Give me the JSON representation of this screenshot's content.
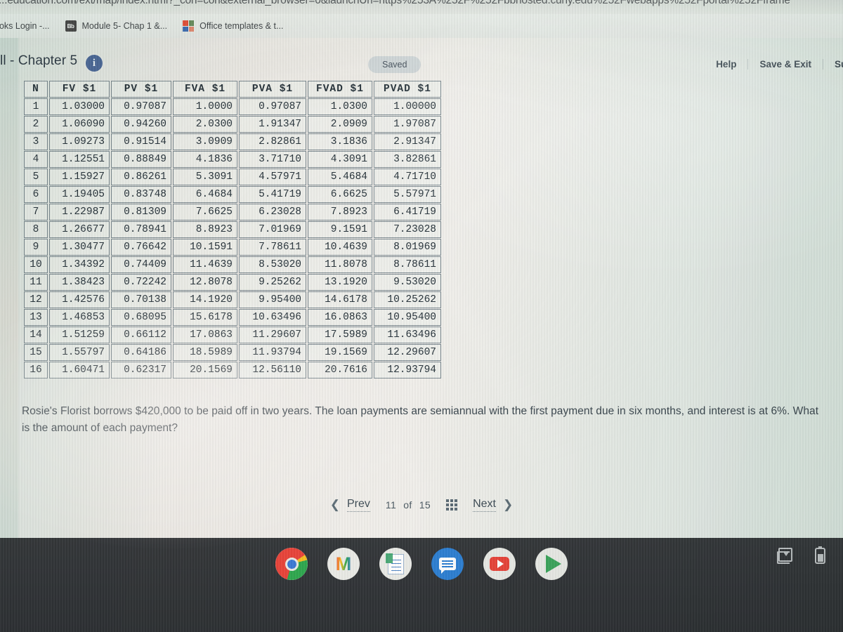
{
  "browser": {
    "url_text": "...education.com/ext/map/index.html?_con=con&external_browser=0&launchUrl=https%253A%252F%252Fbbhosted.cuny.edu%252Fwebapps%252Fportal%252Fframe",
    "bookmarks": [
      {
        "label": "ooks Login -...",
        "icon": "none"
      },
      {
        "label": "Module 5- Chap 1 &...",
        "icon": "blackboard-icon"
      },
      {
        "label": "Office templates & t...",
        "icon": "microsoft-icon"
      }
    ]
  },
  "app": {
    "title": "ll - Chapter 5",
    "info_icon": "info-icon",
    "status_badge": "Saved",
    "actions": [
      {
        "label": "Help"
      },
      {
        "label": "Save & Exit"
      },
      {
        "label": "Su"
      }
    ]
  },
  "table": {
    "headers": [
      "N",
      "FV $1",
      "PV $1",
      "FVA $1",
      "PVA $1",
      "FVAD $1",
      "PVAD $1"
    ],
    "rows": [
      [
        "1",
        "1.03000",
        "0.97087",
        "1.0000",
        "0.97087",
        "1.0300",
        "1.00000"
      ],
      [
        "2",
        "1.06090",
        "0.94260",
        "2.0300",
        "1.91347",
        "2.0909",
        "1.97087"
      ],
      [
        "3",
        "1.09273",
        "0.91514",
        "3.0909",
        "2.82861",
        "3.1836",
        "2.91347"
      ],
      [
        "4",
        "1.12551",
        "0.88849",
        "4.1836",
        "3.71710",
        "4.3091",
        "3.82861"
      ],
      [
        "5",
        "1.15927",
        "0.86261",
        "5.3091",
        "4.57971",
        "5.4684",
        "4.71710"
      ],
      [
        "6",
        "1.19405",
        "0.83748",
        "6.4684",
        "5.41719",
        "6.6625",
        "5.57971"
      ],
      [
        "7",
        "1.22987",
        "0.81309",
        "7.6625",
        "6.23028",
        "7.8923",
        "6.41719"
      ],
      [
        "8",
        "1.26677",
        "0.78941",
        "8.8923",
        "7.01969",
        "9.1591",
        "7.23028"
      ],
      [
        "9",
        "1.30477",
        "0.76642",
        "10.1591",
        "7.78611",
        "10.4639",
        "8.01969"
      ],
      [
        "10",
        "1.34392",
        "0.74409",
        "11.4639",
        "8.53020",
        "11.8078",
        "8.78611"
      ],
      [
        "11",
        "1.38423",
        "0.72242",
        "12.8078",
        "9.25262",
        "13.1920",
        "9.53020"
      ],
      [
        "12",
        "1.42576",
        "0.70138",
        "14.1920",
        "9.95400",
        "14.6178",
        "10.25262"
      ],
      [
        "13",
        "1.46853",
        "0.68095",
        "15.6178",
        "10.63496",
        "16.0863",
        "10.95400"
      ],
      [
        "14",
        "1.51259",
        "0.66112",
        "17.0863",
        "11.29607",
        "17.5989",
        "11.63496"
      ],
      [
        "15",
        "1.55797",
        "0.64186",
        "18.5989",
        "11.93794",
        "19.1569",
        "12.29607"
      ],
      [
        "16",
        "1.60471",
        "0.62317",
        "20.1569",
        "12.56110",
        "20.7616",
        "12.93794"
      ]
    ]
  },
  "question": {
    "text": "Rosie's Florist borrows $420,000 to be paid off in two years. The loan payments are semiannual with the first payment due in six months, and interest is at 6%. What is the amount of each payment?"
  },
  "pager": {
    "prev_label": "Prev",
    "next_label": "Next",
    "current": "11",
    "of_label": "of",
    "total": "15",
    "grid_icon": "grid-icon"
  },
  "shelf": {
    "apps": [
      {
        "name": "chrome-icon",
        "active": true
      },
      {
        "name": "gmail-icon",
        "active": false
      },
      {
        "name": "google-docs-icon",
        "active": false
      },
      {
        "name": "messages-icon",
        "active": false
      },
      {
        "name": "youtube-icon",
        "active": false
      },
      {
        "name": "play-store-icon",
        "active": false
      }
    ],
    "tray": [
      {
        "name": "screen-capture-icon"
      },
      {
        "name": "battery-icon"
      }
    ]
  },
  "colors": {
    "accent_blue": "#4d6a9a",
    "page_bg": "#eceae6",
    "shelf_bg": "#34373a",
    "text_dark": "#26323a"
  }
}
